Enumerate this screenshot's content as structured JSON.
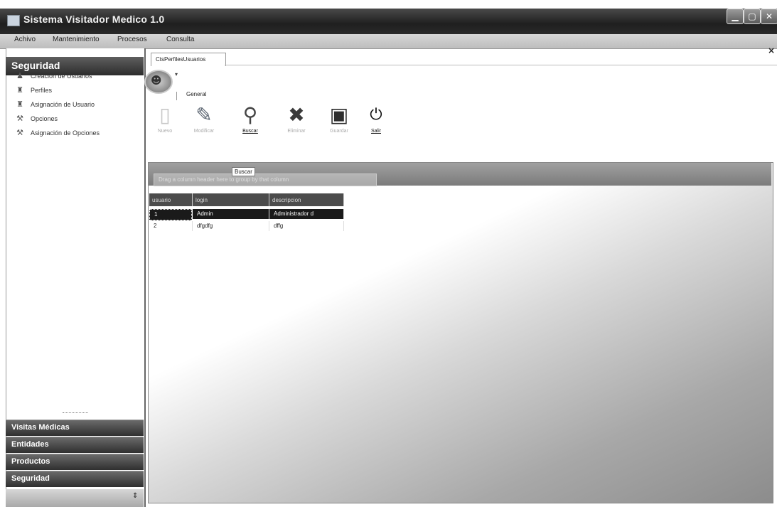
{
  "window": {
    "title": "Sistema Visitador Medico 1.0",
    "controls": {
      "minimize": "▁",
      "maximize": "▢",
      "close": "✕"
    }
  },
  "menu": [
    "Achivo",
    "Mantenimiento",
    "Procesos",
    "Consulta"
  ],
  "sidebar": {
    "header": "Seguridad",
    "items": [
      {
        "label": "Creación de Usuarios",
        "icon": "user-icon"
      },
      {
        "label": "Perfiles",
        "icon": "profile-icon"
      },
      {
        "label": "Asignación de Usuario",
        "icon": "assign-user-icon"
      },
      {
        "label": "Opciones",
        "icon": "options-icon"
      },
      {
        "label": "Asignación de Opciones",
        "icon": "assign-options-icon"
      }
    ],
    "groups": [
      "Visitas Médicas",
      "Entidades",
      "Productos",
      "Seguridad"
    ]
  },
  "tab": {
    "label": "CtsPerfilesUsuarios",
    "close": "×"
  },
  "ribbon": {
    "arrow": "▾",
    "tab_label": "General",
    "tools": [
      {
        "label": "Nuevo",
        "icon": "new-icon",
        "glyph": "▯",
        "active": false
      },
      {
        "label": "Modificar",
        "icon": "edit-icon",
        "glyph": "✎",
        "active": false
      },
      {
        "label": "Buscar",
        "icon": "search-icon",
        "glyph": "⚲",
        "active": true
      },
      {
        "label": "Eliminar",
        "icon": "delete-icon",
        "glyph": "✖",
        "active": false
      },
      {
        "label": "Guardar",
        "icon": "save-icon",
        "glyph": "▣",
        "active": false
      },
      {
        "label": "Salir",
        "icon": "exit-icon",
        "glyph": "⏻",
        "active": true
      }
    ]
  },
  "grid": {
    "group_hint": "Drag a column header here to group by that column",
    "search_tooltip": "Buscar",
    "columns": [
      "usuario",
      "login",
      "descripcion"
    ],
    "rows": [
      {
        "usuario": "1",
        "login": "Admin",
        "descripcion": "Administrador d"
      },
      {
        "usuario": "2",
        "login": "dfgdfg",
        "descripcion": "dffg"
      }
    ]
  },
  "colors": {
    "titlebar": "#2a2a2a",
    "selected_row": "#1a1a1a",
    "header_cell": "#4c4c4c"
  }
}
